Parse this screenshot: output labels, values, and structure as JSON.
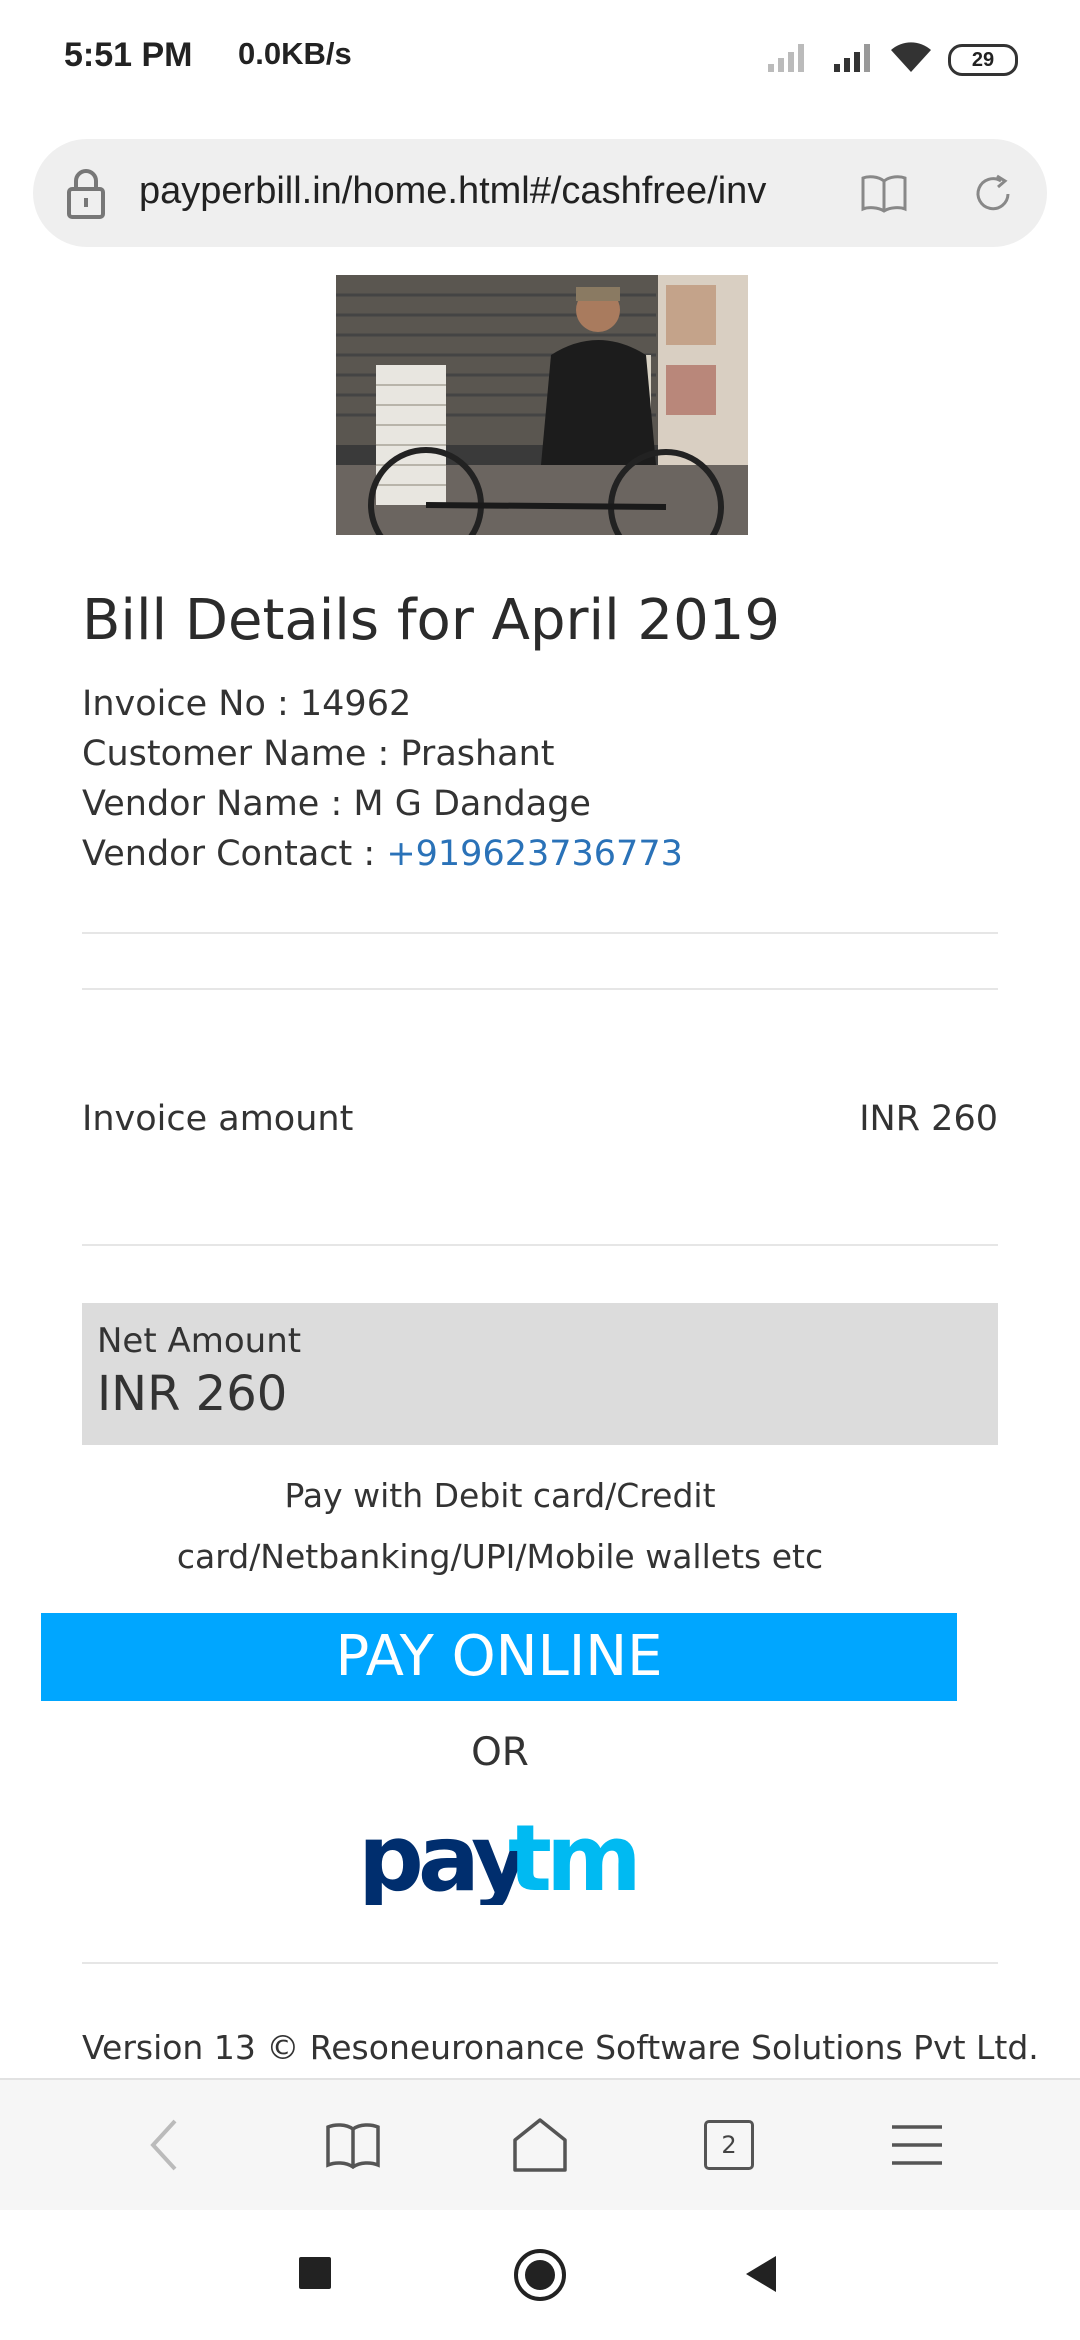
{
  "status_bar": {
    "time": "5:51 PM",
    "net_speed": "0.0KB/s",
    "battery": "29"
  },
  "browser": {
    "url": "payperbill.in/home.html#/cashfree/inv",
    "tab_count": "2"
  },
  "bill": {
    "title": "Bill Details for April 2019",
    "invoice_no": "Invoice No : 14962",
    "customer_name": "Customer Name : Prashant",
    "vendor_name": "Vendor Name : M G Dandage",
    "vendor_contact_label": "Vendor Contact : ",
    "vendor_contact_phone": "+919623736773"
  },
  "invoice": {
    "label": "Invoice amount",
    "value": "INR 260"
  },
  "net": {
    "label": "Net Amount",
    "value": "INR 260"
  },
  "payment": {
    "note": "Pay with Debit card/Credit card/Netbanking/UPI/Mobile wallets etc",
    "button_label": "PAY ONLINE",
    "or_text": "OR",
    "paytm_pay": "pay",
    "paytm_tm": "tm"
  },
  "footer": {
    "text": "Version 13 © Resoneuronance Software Solutions Pvt Ltd."
  },
  "colors": {
    "accent_button": "#00a6ff",
    "link": "#2a72b8",
    "paytm_dark": "#002e6e",
    "paytm_light": "#00baf2",
    "net_box": "#dcdcdc"
  },
  "icons": [
    "lock-icon",
    "reader-mode-icon",
    "refresh-icon",
    "back-icon",
    "bookmarks-icon",
    "home-icon",
    "tabs-icon",
    "menu-icon",
    "recents-icon",
    "home-nav-icon",
    "back-nav-icon",
    "signal-icon",
    "wifi-icon",
    "battery-icon"
  ]
}
